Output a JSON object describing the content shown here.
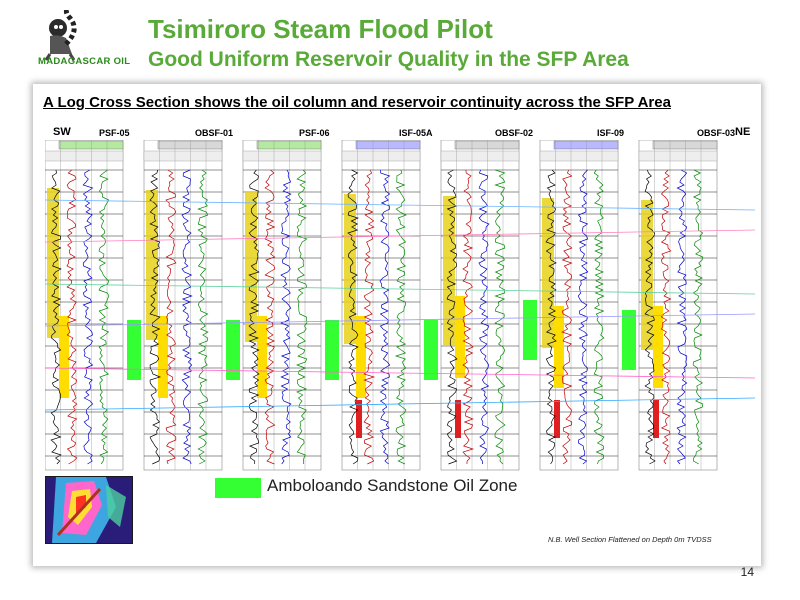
{
  "logo": {
    "text": "MADAGASCAR OIL",
    "icon": "lemur-icon"
  },
  "header": {
    "title": "Tsimiroro Steam Flood Pilot",
    "subtitle": "Good Uniform Reservoir Quality in the SFP Area"
  },
  "section": {
    "heading": "A Log Cross Section shows the oil column and reservoir continuity across the SFP Area",
    "left_direction": "SW",
    "right_direction": "NE",
    "wells": [
      "PSF-05",
      "OBSF-01",
      "PSF-06",
      "ISF-05A",
      "OBSF-02",
      "ISF-09",
      "OBSF-03"
    ]
  },
  "legend": {
    "label": "Amboloando Sandstone Oil Zone",
    "color": "#33ff33"
  },
  "note": "N.B. Well Section Flattened on Depth 0m TVDSS",
  "page_number": "14"
}
